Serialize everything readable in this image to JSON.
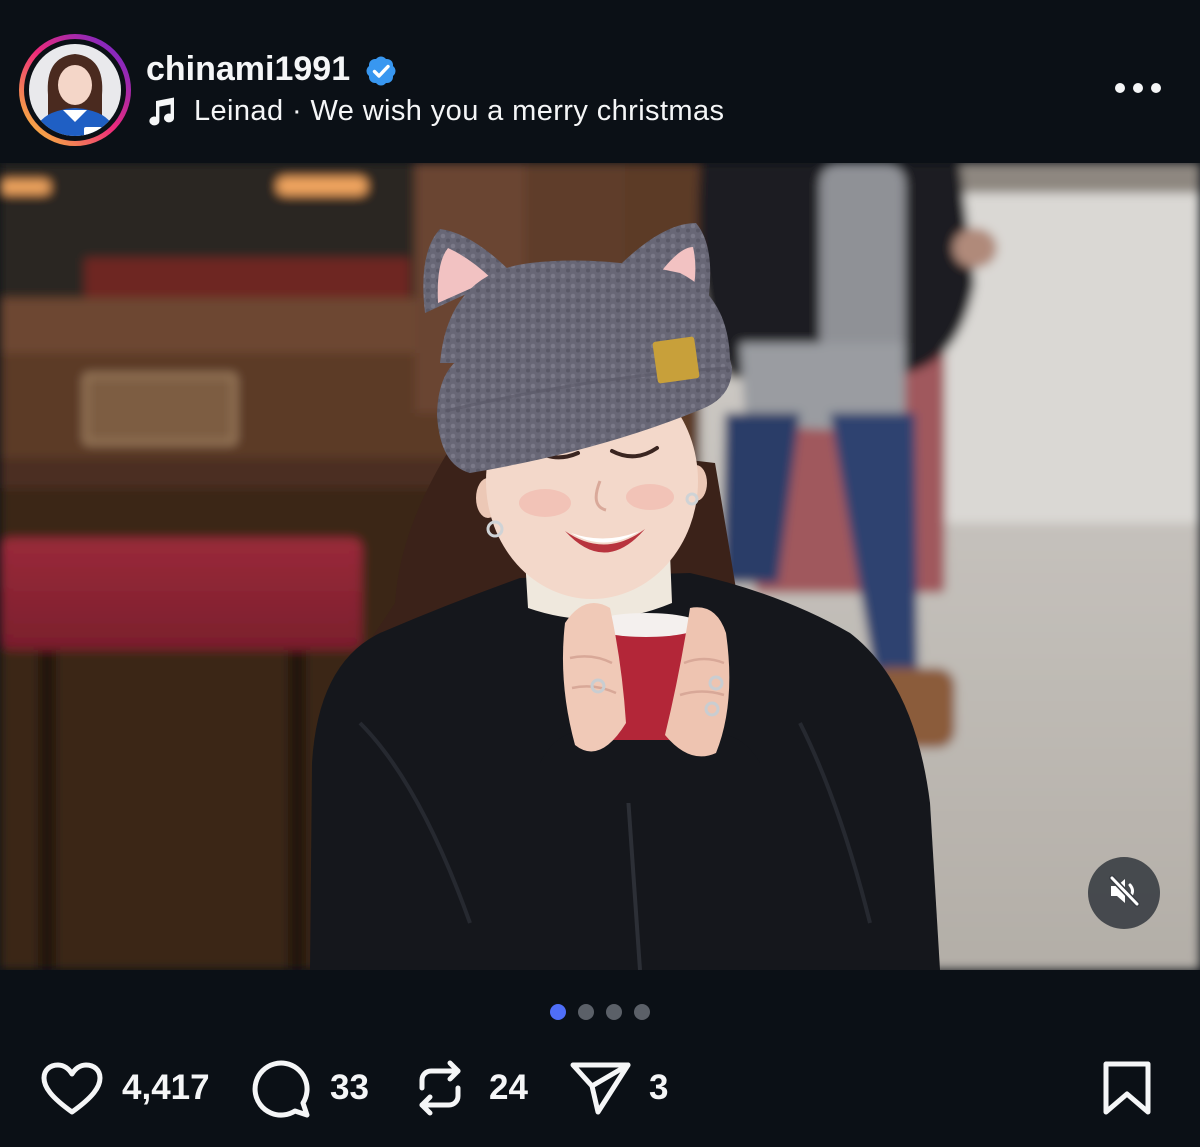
{
  "post": {
    "author": {
      "username": "chinami1991",
      "verified": true
    },
    "music": {
      "icon": "music-note-icon",
      "label": "Leinad · We wish you a merry christmas"
    },
    "menu_icon": "more-options-icon"
  },
  "media": {
    "audio_muted": true,
    "mute_icon": "speaker-muted-icon",
    "carousel": {
      "count": 4,
      "active_index": 0
    }
  },
  "actions": {
    "like": {
      "icon": "heart-icon",
      "count": "4,417"
    },
    "comment": {
      "icon": "comment-icon",
      "count": "33"
    },
    "repost": {
      "icon": "repost-icon",
      "count": "24"
    },
    "share": {
      "icon": "send-icon",
      "count": "3"
    },
    "save": {
      "icon": "bookmark-icon"
    }
  },
  "colors": {
    "background": "#0b1016",
    "text": "#f5f6f7",
    "verified": "#3897f0",
    "dot_active": "#4f6ef7",
    "dot_inactive": "#5b6068",
    "avatar_ring": [
      "#f9ce34",
      "#ee2a7b",
      "#6228d7"
    ]
  }
}
